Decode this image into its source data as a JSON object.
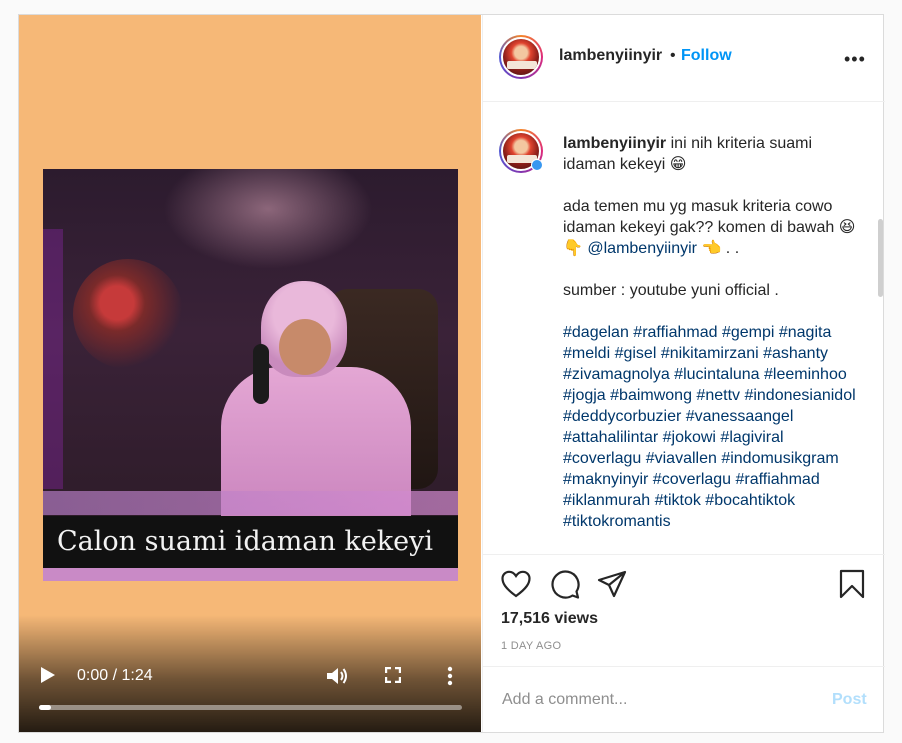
{
  "video": {
    "caption": "Calon suami idaman kekeyi",
    "time": "0:00 / 1:24",
    "progress_fraction": 0.0,
    "icons": [
      "play-icon",
      "volume-icon",
      "fullscreen-icon",
      "more-vertical-icon"
    ]
  },
  "header": {
    "username": "lambenyiinyir",
    "dot": "•",
    "follow_label": "Follow",
    "more": "•••"
  },
  "post": {
    "username": "lambenyiinyir",
    "line1": "ini nih kriteria suami idaman kekeyi 😁",
    "line2": "ada temen mu yg masuk kriteria cowo idaman kekeyi gak?? komen di bawah 😆👇",
    "mention": "@lambenyiinyir",
    "line2_end": "👈 . .",
    "source": "sumber : youtube yuni official .",
    "hashtags": "#dagelan #raffiahmad #gempi #nagita #meldi #gisel #nikitamirzani #ashanty #zivamagnolya #lucintaluna #leeminhoo #jogja #baimwong #nettv #indonesianidol #deddycorbuzier #vanessaangel #attahalilintar #jokowi #lagiviral #coverlagu #viavallen #indomusikgram #maknyinyir #coverlagu #raffiahmad #iklanmurah #tiktok #bocahtiktok #tiktokromantis"
  },
  "actions": {
    "icons": [
      "heart-icon",
      "comment-icon",
      "share-icon",
      "bookmark-icon"
    ]
  },
  "stats": {
    "views": "17,516 views",
    "ago": "1 DAY AGO"
  },
  "comment_box": {
    "placeholder": "Add a comment...",
    "post_label": "Post"
  },
  "colors": {
    "video_bg": "#f6b877",
    "follow": "#0095f6",
    "hashtag": "#00376b",
    "post_disabled": "#b2dffc"
  }
}
